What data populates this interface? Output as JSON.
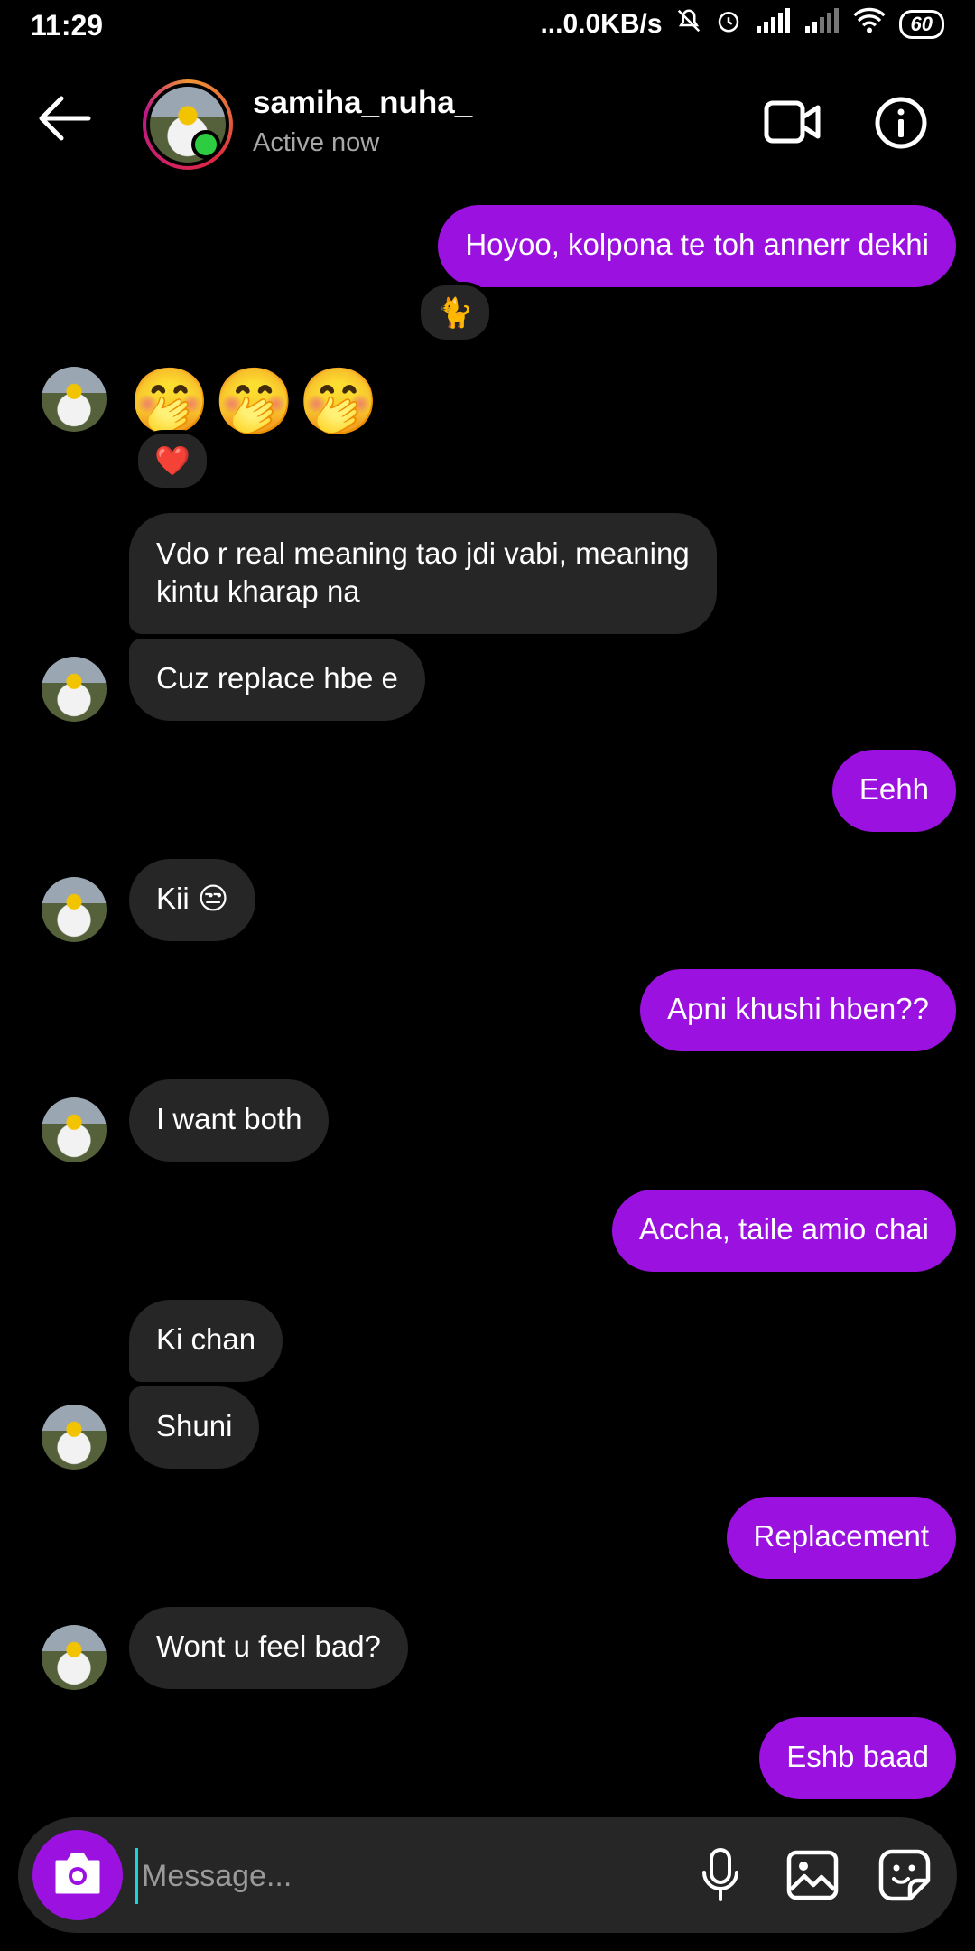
{
  "status_bar": {
    "time": "11:29",
    "net_speed": "...0.0KB/s",
    "battery": "60"
  },
  "header": {
    "username": "samiha_nuha_",
    "status": "Active now",
    "icons": [
      "back-arrow-icon",
      "video-call-icon",
      "info-icon"
    ]
  },
  "messages": [
    {
      "from": "me",
      "text": "Hoyoo, kolpona te toh annerr dekhi",
      "reaction": "🐈"
    },
    {
      "from": "them",
      "text": "🤭🤭🤭",
      "reaction": "❤️"
    },
    {
      "from": "them",
      "text": "Vdo r real meaning tao jdi vabi, meaning kintu kharap na"
    },
    {
      "from": "them",
      "text": "Cuz replace hbe e"
    },
    {
      "from": "me",
      "text": "Eehh"
    },
    {
      "from": "them",
      "text": "Kii 😒"
    },
    {
      "from": "me",
      "text": "Apni khushi hben??"
    },
    {
      "from": "them",
      "text": "I want both"
    },
    {
      "from": "me",
      "text": "Accha, taile amio chai"
    },
    {
      "from": "them",
      "text": "Ki chan"
    },
    {
      "from": "them",
      "text": "Shuni"
    },
    {
      "from": "me",
      "text": "Replacement"
    },
    {
      "from": "them",
      "text": "Wont u feel bad?"
    },
    {
      "from": "me",
      "text": "Eshb baad"
    }
  ],
  "message_lines": {
    "m2_line1": "Vdo r real meaning tao jdi vabi, meaning",
    "m2_line2": "kintu kharap na"
  },
  "composer": {
    "placeholder": "Message...",
    "icons": [
      "camera-icon",
      "microphone-icon",
      "gallery-icon",
      "sticker-icon"
    ]
  },
  "colors": {
    "outgoing_bubble": "#9b11e0",
    "incoming_bubble": "#262626",
    "background": "#000000"
  }
}
